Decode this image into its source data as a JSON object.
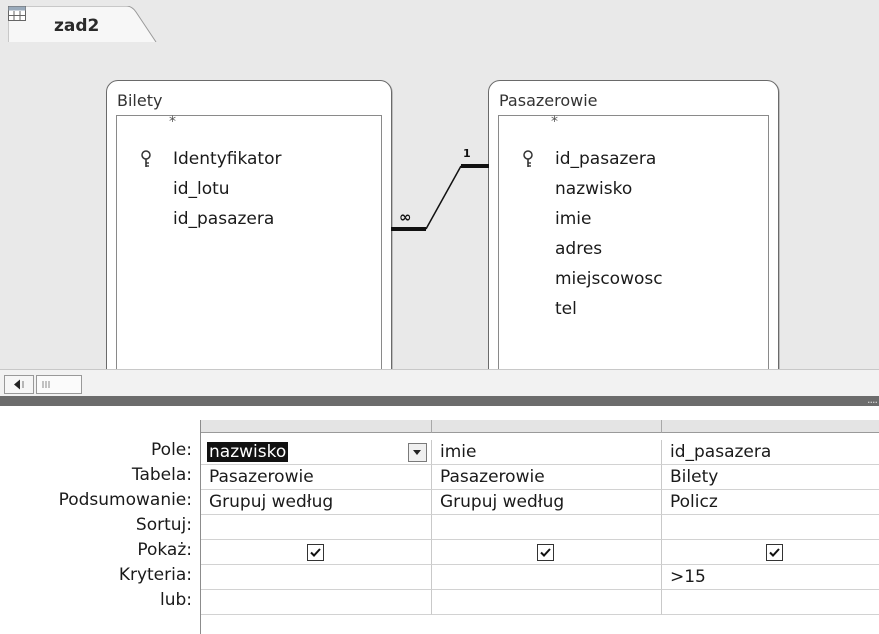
{
  "tab": {
    "title": "zad2"
  },
  "tables": [
    {
      "name": "Bilety",
      "fields": [
        "*",
        "Identyfikator",
        "id_lotu",
        "id_pasazera"
      ],
      "key_field_index": 1
    },
    {
      "name": "Pasazerowie",
      "fields": [
        "*",
        "id_pasazera",
        "nazwisko",
        "imie",
        "adres",
        "miejscowosc",
        "tel"
      ],
      "key_field_index": 1
    }
  ],
  "relationship": {
    "one_side": "1",
    "many_side": "∞"
  },
  "grid": {
    "row_labels": {
      "field": "Pole:",
      "table": "Tabela:",
      "total": "Podsumowanie:",
      "sort": "Sortuj:",
      "show": "Pokaż:",
      "criteria": "Kryteria:",
      "or": "lub:"
    },
    "columns": [
      {
        "field": "nazwisko",
        "table": "Pasazerowie",
        "total": "Grupuj według",
        "sort": "",
        "show": true,
        "criteria": "",
        "or": ""
      },
      {
        "field": "imie",
        "table": "Pasazerowie",
        "total": "Grupuj według",
        "sort": "",
        "show": true,
        "criteria": "",
        "or": ""
      },
      {
        "field": "id_pasazera",
        "table": "Bilety",
        "total": "Policz",
        "sort": "",
        "show": true,
        "criteria": ">15",
        "or": ""
      }
    ]
  },
  "colors": {
    "background": "#e9e9e9",
    "splitter": "#6c6c6c",
    "selection": "#111111"
  },
  "icons": {
    "tab": "query-design-icon",
    "key": "primary-key-icon",
    "scroll_left": "scroll-left-arrow-icon",
    "check": "checkmark-icon"
  }
}
